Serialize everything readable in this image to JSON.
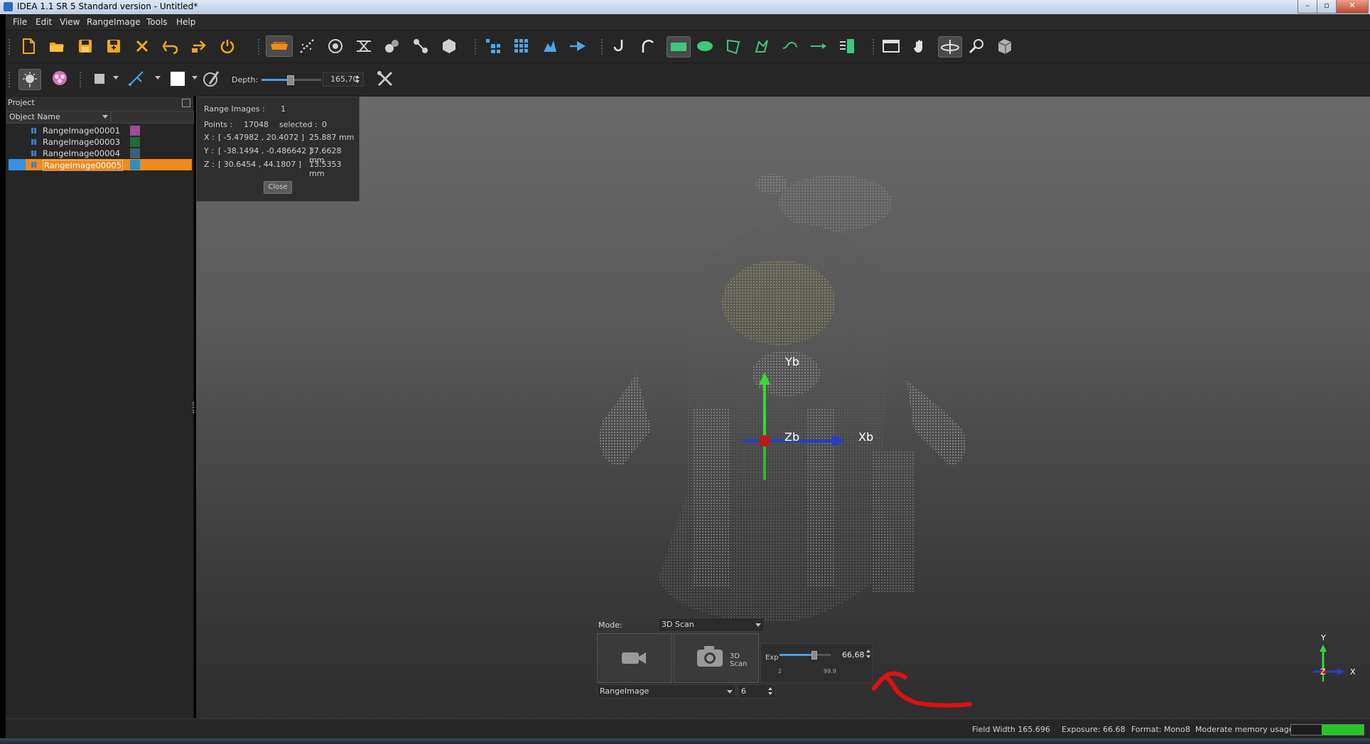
{
  "window": {
    "title": "IDEA 1.1 SR 5 Standard version - Untitled*",
    "controls": [
      "–",
      "▫",
      "✕"
    ]
  },
  "menubar": {
    "items": [
      "File",
      "Edit",
      "View",
      "RangeImage",
      "Tools",
      "Help"
    ]
  },
  "toolbar2": {
    "depth_label": "Depth:",
    "depth_value": "165,70"
  },
  "project": {
    "panel_title": "Project",
    "column_header": "Object Name",
    "items": [
      {
        "label": "RangeImage00001",
        "color": "#a24a9a",
        "selected": false
      },
      {
        "label": "RangeImage00003",
        "color": "#1f6a3a",
        "selected": false
      },
      {
        "label": "RangeImage00004",
        "color": "#3c5e78",
        "selected": false
      },
      {
        "label": "RangeImage00005",
        "color": "#2f8ec0",
        "selected": true
      }
    ]
  },
  "info": {
    "range_images_label": "Range Images :",
    "range_images_value": "1",
    "points_label": "Points :",
    "points_value": "17048",
    "selected_label": "selected :",
    "selected_value": "0",
    "x_label": "X :",
    "x_range": "[ -5.47982 , 20.4072 ]",
    "x_size": "25.887 mm",
    "y_label": "Y :",
    "y_range": "[ -38.1494 , -0.486642 ]",
    "y_size": "37.6628 mm",
    "z_label": "Z :",
    "z_range": "[ 30.6454 , 44.1807 ]",
    "z_size": "13.5353 mm",
    "close_label": "Close"
  },
  "axes": {
    "yb": "Yb",
    "zb": "Zb",
    "xb": "Xb",
    "mini_y": "Y",
    "mini_x": "X",
    "mini_z": "Z"
  },
  "scan": {
    "mode_label": "Mode:",
    "mode_value": "3D Scan",
    "scan_button_label": "3D Scan",
    "exp_label": "Exp",
    "exp_value": "66,68",
    "exp_min": "2",
    "exp_max": "99.9",
    "exp_level": 0.67,
    "source_value": "RangeImage",
    "count_value": "6"
  },
  "status": {
    "field_width": "Field Width 165.696",
    "exposure": "Exposure: 66.68",
    "format": "Format: Mono8",
    "memory": "Moderate memory usage",
    "memory_level": 0.58
  },
  "colors": {
    "accent_orange": "#f08a1c",
    "axis_green": "#38d838",
    "axis_blue": "#2040d0",
    "axis_red": "#c01818",
    "annotation_red": "#e01010"
  }
}
